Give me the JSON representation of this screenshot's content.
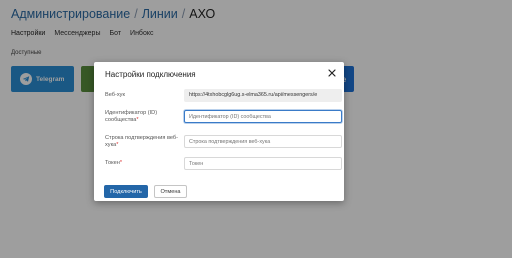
{
  "breadcrumb": {
    "items": [
      "Администрирование",
      "Линии",
      "АХО"
    ],
    "separator": "/"
  },
  "tabs": [
    {
      "label": "Настройки",
      "active": true
    },
    {
      "label": "Мессенджеры",
      "active": false
    },
    {
      "label": "Бот",
      "active": false
    },
    {
      "label": "Инбокс",
      "active": false
    }
  ],
  "section_label": "Доступные",
  "tiles": {
    "telegram": {
      "label": "Telegram",
      "color": "#2b8fd6"
    },
    "right_partial": {
      "label": "те",
      "color": "#1f73d9"
    },
    "green_color": "#5a8f3e"
  },
  "modal": {
    "title": "Настройки подключения",
    "fields": {
      "webhook": {
        "label": "Веб-хук",
        "value": "https://4txhobcglg6ug.s-elma365.ru/api/messengers/e",
        "required": false
      },
      "community_id": {
        "label": "Идентификатор (ID) сообщества",
        "placeholder": "Идентификатор (ID) сообщества",
        "required": true
      },
      "confirm_string": {
        "label": "Строка подтверждения веб-хука",
        "placeholder": "Строка подтверждения веб-хука",
        "required": true
      },
      "token": {
        "label": "Токен",
        "placeholder": "Токен",
        "required": true
      }
    },
    "buttons": {
      "connect": "Подключить",
      "cancel": "Отмена"
    },
    "accent_color": "#2366a8"
  }
}
